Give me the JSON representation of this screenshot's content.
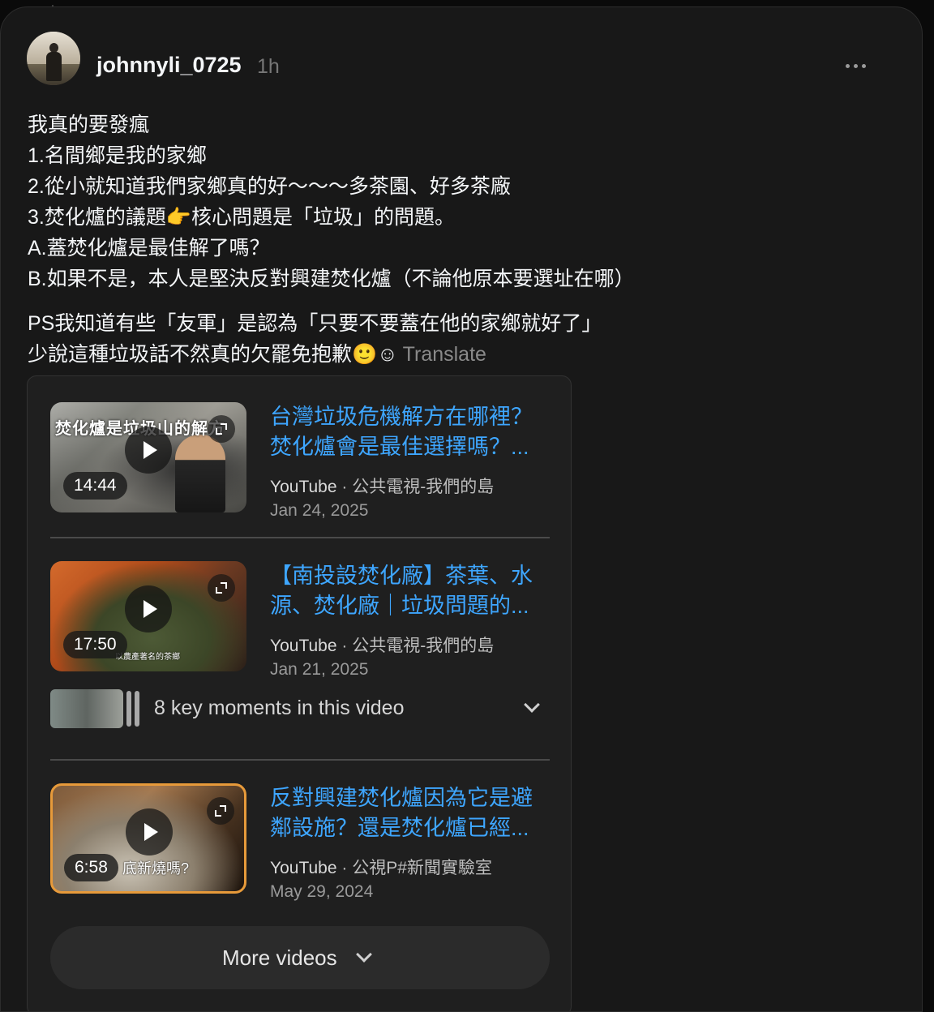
{
  "post": {
    "username": "johnnyli_0725",
    "time": "1h",
    "lines": [
      "我真的要發瘋",
      "1.名間鄉是我的家鄉",
      "2.從小就知道我們家鄉真的好～～～多茶園、好多茶廠",
      "3.焚化爐的議題👉核心問題是「垃圾」的問題。",
      "A.蓋焚化爐是最佳解了嗎？",
      "B.如果不是，本人是堅決反對興建焚化爐（不論他原本要選址在哪）"
    ],
    "ps_lines": [
      "PS我知道有些「友軍」是認為「只要不要蓋在他的家鄉就好了」",
      "少說這種垃圾話不然真的欠罷免抱歉🙂☺"
    ],
    "translate_label": "Translate"
  },
  "videos": [
    {
      "title": "台灣垃圾危機解方在哪裡？焚化爐會是最佳選擇嗎？...",
      "source": "YouTube",
      "channel": "公共電視-我們的島",
      "date": "Jan 24, 2025",
      "duration": "14:44",
      "thumb_caption": "焚化爐是垃圾山的解方",
      "thumb_subcaption": ""
    },
    {
      "title": "【南投設焚化廠】茶葉、水源、焚化廠｜垃圾問題的...",
      "source": "YouTube",
      "channel": "公共電視-我們的島",
      "date": "Jan 21, 2025",
      "duration": "17:50",
      "thumb_caption": "",
      "thumb_subcaption": "以農產著名的茶鄉"
    },
    {
      "title": "反對興建焚化爐因為它是避鄰設施？還是焚化爐已經...",
      "source": "YouTube",
      "channel": "公視P#新聞實驗室",
      "date": "May 29, 2024",
      "duration": "6:58",
      "thumb_caption": "",
      "thumb_subcaption": "底新燒嗎?"
    }
  ],
  "key_moments_label": "8 key moments in this video",
  "more_videos_label": "More videos",
  "colors": {
    "background": "#0a0a0a",
    "card": "#181818",
    "link": "#3ea6ff",
    "muted": "#777777"
  }
}
